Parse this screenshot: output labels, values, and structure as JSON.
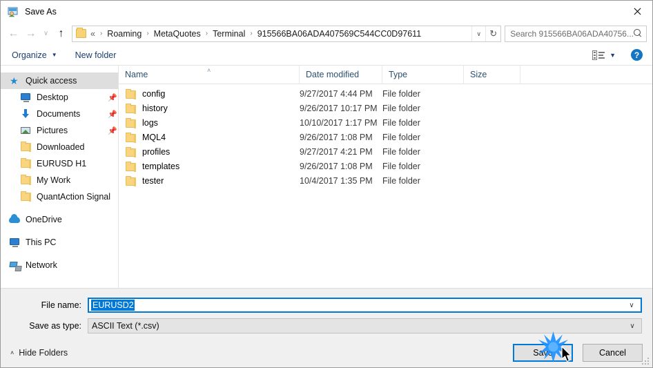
{
  "window": {
    "title": "Save As",
    "icon": "save-as-icon",
    "close_label": "✕"
  },
  "nav": {
    "back": "←",
    "forward": "→",
    "recent": "∨",
    "up": "↑",
    "refresh": "↻",
    "address_chevron": "∨",
    "breadcrumb_prefix": "«",
    "breadcrumbs": [
      {
        "label": "Roaming"
      },
      {
        "label": "MetaQuotes"
      },
      {
        "label": "Terminal"
      },
      {
        "label": "915566BA06ADA407569C544CC0D97611"
      }
    ],
    "separator": "›"
  },
  "search": {
    "placeholder": "Search 915566BA06ADA40756...",
    "icon": "search-icon"
  },
  "toolbar": {
    "organize_label": "Organize",
    "organize_caret": "▼",
    "new_folder_label": "New folder",
    "view_caret": "▼",
    "help_label": "?"
  },
  "sidebar": {
    "items": [
      {
        "label": "Quick access",
        "icon": "star-icon",
        "selected": true,
        "pinned": false,
        "level": 0
      },
      {
        "label": "Desktop",
        "icon": "monitor-icon",
        "selected": false,
        "pinned": true,
        "level": 1
      },
      {
        "label": "Documents",
        "icon": "down-arrow-icon",
        "selected": false,
        "pinned": true,
        "level": 1
      },
      {
        "label": "Pictures",
        "icon": "picture-icon",
        "selected": false,
        "pinned": true,
        "level": 1
      },
      {
        "label": "Downloaded",
        "icon": "folder-icon",
        "selected": false,
        "pinned": false,
        "level": 1
      },
      {
        "label": "EURUSD H1",
        "icon": "folder-icon",
        "selected": false,
        "pinned": false,
        "level": 1
      },
      {
        "label": "My Work",
        "icon": "folder-icon",
        "selected": false,
        "pinned": false,
        "level": 1
      },
      {
        "label": "QuantAction Signal",
        "icon": "folder-icon",
        "selected": false,
        "pinned": false,
        "level": 1
      },
      {
        "label": "OneDrive",
        "icon": "cloud-icon",
        "selected": false,
        "pinned": false,
        "level": 0
      },
      {
        "label": "This PC",
        "icon": "monitor-icon",
        "selected": false,
        "pinned": false,
        "level": 0
      },
      {
        "label": "Network",
        "icon": "network-icon",
        "selected": false,
        "pinned": false,
        "level": 0
      }
    ],
    "pin_glyph": "📌"
  },
  "filelist": {
    "columns": [
      {
        "key": "name",
        "label": "Name"
      },
      {
        "key": "date",
        "label": "Date modified"
      },
      {
        "key": "type",
        "label": "Type"
      },
      {
        "key": "size",
        "label": "Size"
      }
    ],
    "sort_caret": "˄",
    "rows": [
      {
        "name": "config",
        "date": "9/27/2017 4:44 PM",
        "type": "File folder",
        "size": ""
      },
      {
        "name": "history",
        "date": "9/26/2017 10:17 PM",
        "type": "File folder",
        "size": ""
      },
      {
        "name": "logs",
        "date": "10/10/2017 1:17 PM",
        "type": "File folder",
        "size": ""
      },
      {
        "name": "MQL4",
        "date": "9/26/2017 1:08 PM",
        "type": "File folder",
        "size": ""
      },
      {
        "name": "profiles",
        "date": "9/27/2017 4:21 PM",
        "type": "File folder",
        "size": ""
      },
      {
        "name": "templates",
        "date": "9/26/2017 1:08 PM",
        "type": "File folder",
        "size": ""
      },
      {
        "name": "tester",
        "date": "10/4/2017 1:35 PM",
        "type": "File folder",
        "size": ""
      }
    ]
  },
  "form": {
    "filename_label": "File name:",
    "filename_value": "EURUSD2",
    "savetype_label": "Save as type:",
    "savetype_value": "ASCII Text (*.csv)",
    "dropdown_caret": "∨"
  },
  "footer": {
    "hide_folders_label": "Hide Folders",
    "hide_folders_caret": "˄",
    "save_label": "Save",
    "cancel_label": "Cancel"
  },
  "colors": {
    "accent": "#0078d7",
    "folder": "#f8d57e",
    "header_text": "#2b5070",
    "toolbar_text": "#1b3f6e",
    "chrome_bg": "#f0f0f0",
    "help_blue": "#1475c4",
    "burst": "#1e90ff"
  }
}
